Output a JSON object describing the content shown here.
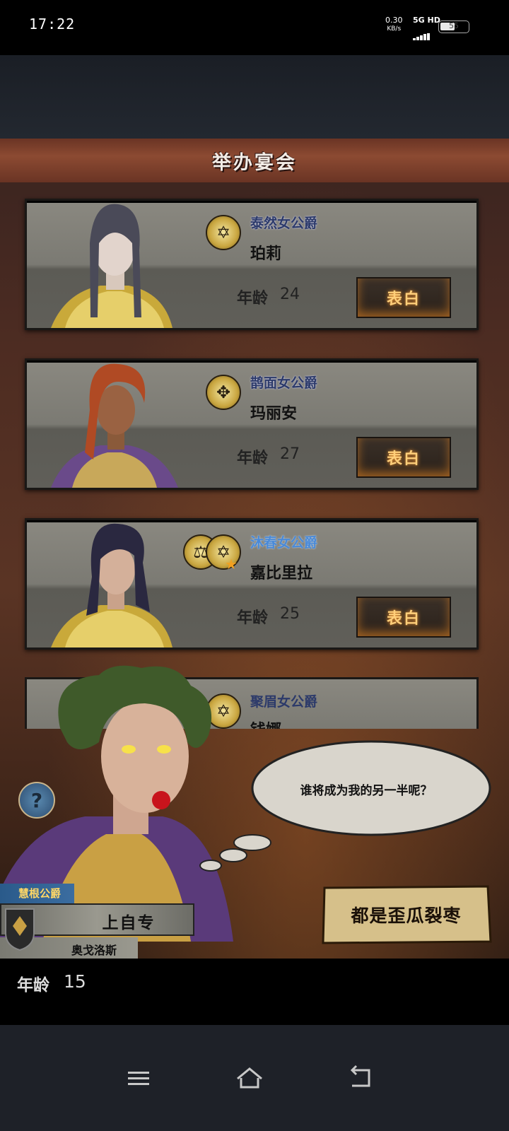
{
  "status": {
    "time": "17:22",
    "net_speed_value": "0.30",
    "net_speed_unit": "KB/s",
    "network": "5G HD",
    "battery": "55"
  },
  "header": {
    "title": "举办宴会"
  },
  "candidates": [
    {
      "title": "泰然女公爵",
      "name": "珀莉",
      "age_label": "年龄",
      "age": "24",
      "button": "表白",
      "emblem_icons": [
        "star-of-david-eye-icon"
      ]
    },
    {
      "title": "鹊面女公爵",
      "name": "玛丽安",
      "age_label": "年龄",
      "age": "27",
      "button": "表白",
      "emblem_icons": [
        "compass-rose-icon"
      ]
    },
    {
      "title": "沐春女公爵",
      "name": "嘉比里拉",
      "age_label": "年龄",
      "age": "25",
      "button": "表白",
      "emblem_icons": [
        "scales-icon",
        "star-of-david-eye-icon"
      ]
    },
    {
      "title": "聚眉女公爵",
      "name": "钱娜"
    }
  ],
  "speech_bubble": {
    "text": "谁将成为我的另一半呢？"
  },
  "player": {
    "title": "慧根公爵",
    "name": "上自专",
    "house": "奥戈洛斯",
    "age_label": "年龄",
    "age": "15"
  },
  "actions": {
    "reject_label": "都是歪瓜裂枣"
  },
  "colors": {
    "title_dark_blue": "#2c3a6a",
    "title_light_blue": "#4a8ad8",
    "button_text": "#ffcf7a",
    "banner": "#8c4a32"
  }
}
